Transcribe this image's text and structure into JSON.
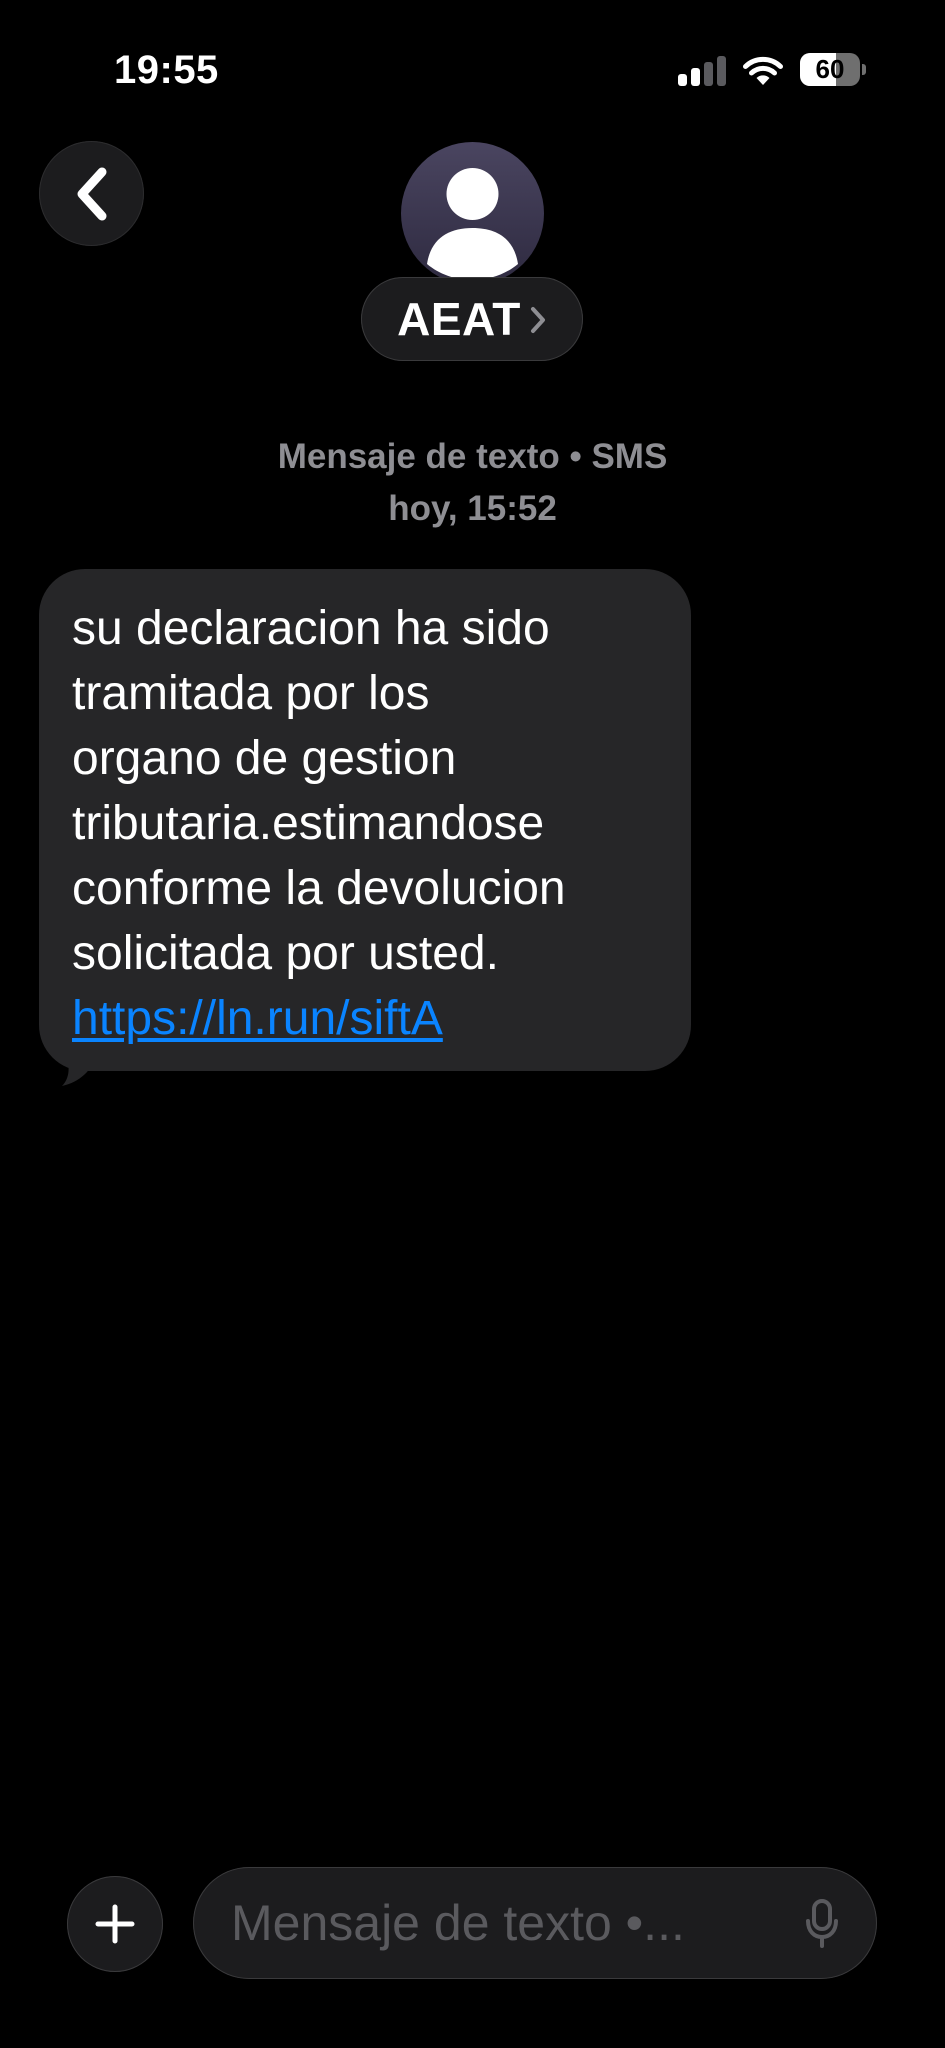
{
  "status_bar": {
    "time": "19:55",
    "signal_bars_active": 2,
    "signal_bars_total": 4,
    "battery_level": "60",
    "battery_fraction": 0.6
  },
  "header": {
    "back_icon": "chevron-left-icon",
    "avatar_icon": "person-icon",
    "contact_name": "AEAT",
    "contact_chevron_icon": "chevron-right-icon"
  },
  "conversation": {
    "service_label": "Mensaje de texto • SMS",
    "timestamp": "hoy, 15:52",
    "messages": [
      {
        "direction": "incoming",
        "text": "su declaracion ha sido\ntramitada por los\norgano de gestion\ntributaria.estimandose\nconforme la devolucion\nsolicitada por usted.",
        "link": "https://ln.run/siftA"
      }
    ]
  },
  "input_bar": {
    "add_icon": "plus-icon",
    "placeholder": "Mensaje de texto •...",
    "mic_icon": "microphone-icon"
  },
  "colors": {
    "background": "#000000",
    "bubble": "#262628",
    "link": "#0a84ff",
    "secondary_text": "#8e8e93"
  }
}
